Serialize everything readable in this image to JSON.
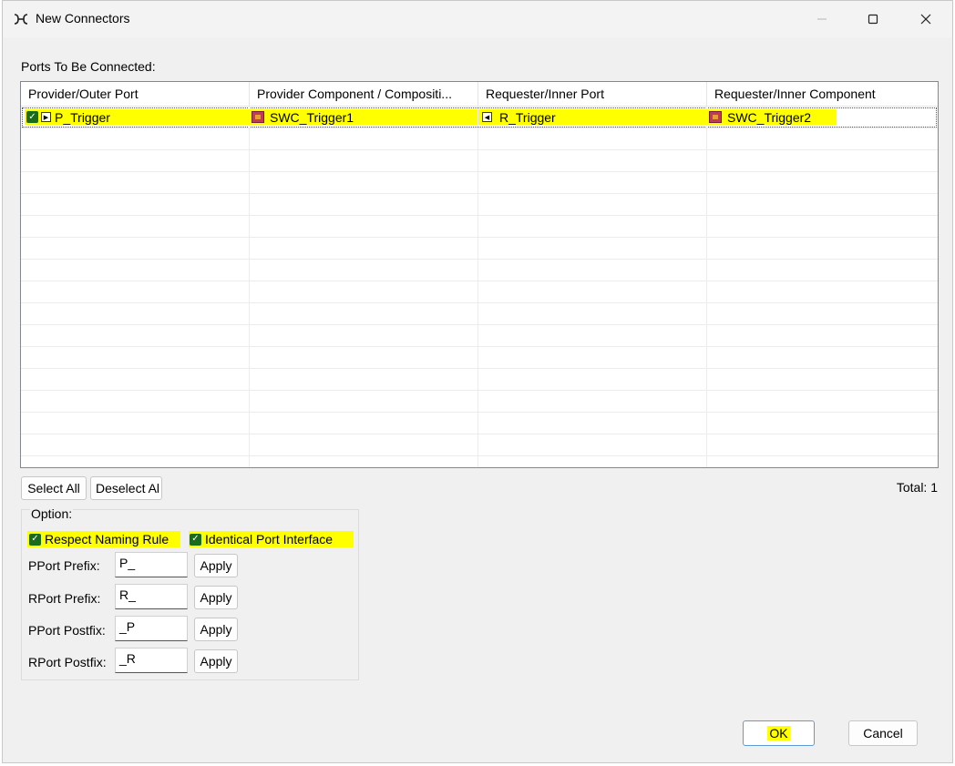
{
  "window": {
    "title": "New Connectors",
    "icon": "connector-icon"
  },
  "ports_label": "Ports To Be Connected:",
  "table": {
    "columns": [
      "Provider/Outer Port",
      "Provider Component / Compositi...",
      "Requester/Inner Port",
      "Requester/Inner Component"
    ],
    "rows": [
      {
        "checked": true,
        "provider_port": "P_Trigger",
        "provider_component": "SWC_Trigger1",
        "requester_port": "R_Trigger",
        "requester_component": "SWC_Trigger2"
      }
    ]
  },
  "buttons": {
    "select_all": "Select All",
    "deselect_all": "Deselect Al",
    "ok": "OK",
    "cancel": "Cancel"
  },
  "total_label": "Total: 1",
  "options": {
    "title": "Option:",
    "respect_naming_rule": {
      "label": "Respect Naming Rule",
      "checked": true
    },
    "identical_port_interface": {
      "label": "Identical Port Interface",
      "checked": true
    },
    "fields": [
      {
        "label": "PPort Prefix:",
        "value": "P_",
        "apply": "Apply"
      },
      {
        "label": "RPort Prefix:",
        "value": "R_",
        "apply": "Apply"
      },
      {
        "label": "PPort Postfix:",
        "value": "_P",
        "apply": "Apply"
      },
      {
        "label": "RPort Postfix:",
        "value": "_R",
        "apply": "Apply"
      }
    ]
  },
  "colors": {
    "highlight": "#ffff00",
    "checkbox": "#1a6b1a",
    "component_icon": "#c23a5a",
    "ok_border": "#5f9bd6"
  }
}
